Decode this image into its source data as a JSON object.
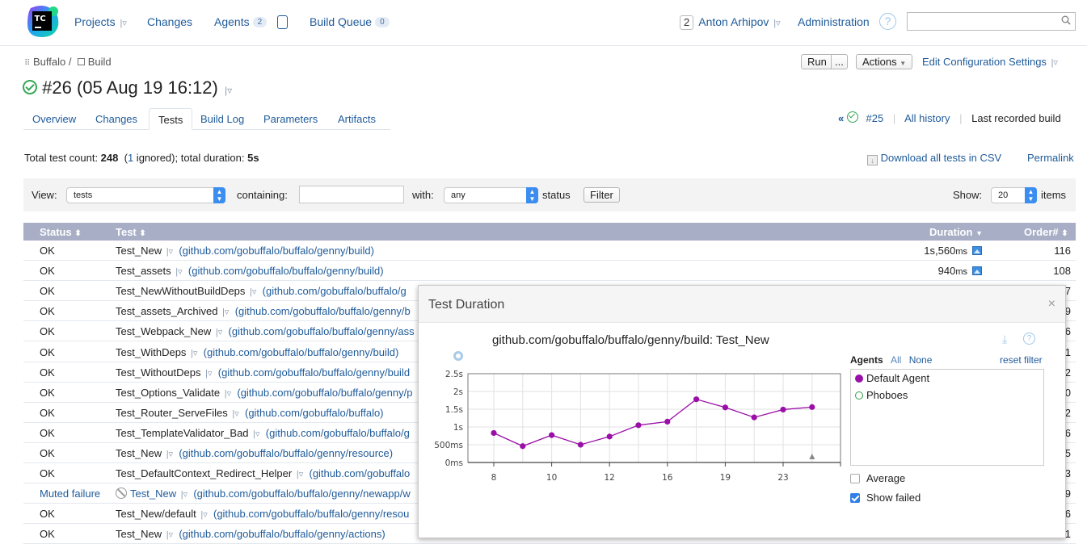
{
  "header": {
    "logo_text": "TC",
    "nav": {
      "projects": "Projects",
      "changes": "Changes",
      "agents": "Agents",
      "agents_count": "2",
      "build_queue": "Build Queue",
      "build_queue_count": "0"
    },
    "user_badge": "2",
    "user_name": "Anton Arhipov",
    "administration": "Administration",
    "search_placeholder": ""
  },
  "breadcrumb": {
    "project": "Buffalo",
    "separator": "/",
    "build_config": "Build"
  },
  "build": {
    "title": "#26 (05 Aug 19 16:12)",
    "status": "success"
  },
  "toolbar": {
    "run": "Run",
    "run_more": "...",
    "actions": "Actions",
    "edit_config": "Edit Configuration Settings"
  },
  "tabs": [
    {
      "label": "Overview"
    },
    {
      "label": "Changes"
    },
    {
      "label": "Tests",
      "active": true
    },
    {
      "label": "Build Log"
    },
    {
      "label": "Parameters"
    },
    {
      "label": "Artifacts"
    }
  ],
  "history_nav": {
    "prev_build": "#25",
    "all_history": "All history",
    "last_recorded": "Last recorded build"
  },
  "summary": {
    "prefix": "Total test count: ",
    "count": "248",
    "ignored_open": "(",
    "ignored_count": "1",
    "ignored_text": " ignored); total duration: ",
    "duration": "5s"
  },
  "links": {
    "download_csv": "Download all tests in CSV",
    "permalink": "Permalink"
  },
  "filter": {
    "view_label": "View:",
    "view_value": "tests",
    "containing_label": "containing:",
    "containing_value": "",
    "with_label": "with:",
    "with_value": "any",
    "status_label": "status",
    "filter_button": "Filter",
    "show_label": "Show:",
    "show_value": "20",
    "items_label": "items"
  },
  "table": {
    "columns": {
      "status": "Status",
      "test": "Test",
      "duration": "Duration",
      "order": "Order#"
    },
    "rows": [
      {
        "status": "OK",
        "name": "Test_New",
        "package": "(github.com/gobuffalo/buffalo/genny/build)",
        "duration": "1s,560",
        "duration_unit": "ms",
        "order": "116"
      },
      {
        "status": "OK",
        "name": "Test_assets",
        "package": "(github.com/gobuffalo/buffalo/genny/build)",
        "duration": "940",
        "duration_unit": "ms",
        "order": "108"
      },
      {
        "status": "OK",
        "name": "Test_NewWithoutBuildDeps",
        "package": "(github.com/gobuffalo/buffalo/g",
        "order": "7"
      },
      {
        "status": "OK",
        "name": "Test_assets_Archived",
        "package": "(github.com/gobuffalo/buffalo/genny/b",
        "order": "9"
      },
      {
        "status": "OK",
        "name": "Test_Webpack_New",
        "package": "(github.com/gobuffalo/buffalo/genny/ass",
        "order": "6"
      },
      {
        "status": "OK",
        "name": "Test_WithDeps",
        "package": "(github.com/gobuffalo/buffalo/genny/build)",
        "order": "1"
      },
      {
        "status": "OK",
        "name": "Test_WithoutDeps",
        "package": "(github.com/gobuffalo/buffalo/genny/build",
        "order": "2"
      },
      {
        "status": "OK",
        "name": "Test_Options_Validate",
        "package": "(github.com/gobuffalo/buffalo/genny/p",
        "order": "0"
      },
      {
        "status": "OK",
        "name": "Test_Router_ServeFiles",
        "package": "(github.com/gobuffalo/buffalo)",
        "order": "2"
      },
      {
        "status": "OK",
        "name": "Test_TemplateValidator_Bad",
        "package": "(github.com/gobuffalo/buffalo/g",
        "order": "6"
      },
      {
        "status": "OK",
        "name": "Test_New",
        "package": "(github.com/gobuffalo/buffalo/genny/resource)",
        "order": "5"
      },
      {
        "status": "OK",
        "name": "Test_DefaultContext_Redirect_Helper",
        "package": "(github.com/gobuffalo",
        "order": "3"
      },
      {
        "status": "Muted failure",
        "name": "Test_New",
        "package": "(github.com/gobuffalo/buffalo/genny/newapp/w",
        "order": "9",
        "muted": true
      },
      {
        "status": "OK",
        "name": "Test_New/default",
        "package": "(github.com/gobuffalo/buffalo/genny/resou",
        "order": "6"
      },
      {
        "status": "OK",
        "name": "Test_New",
        "package": "(github.com/gobuffalo/buffalo/genny/actions)",
        "order": "1"
      }
    ]
  },
  "popup": {
    "title": "Test Duration",
    "close": "×",
    "agents_label": "Agents",
    "all": "All",
    "none": "None",
    "reset_filter": "reset filter",
    "agents": [
      {
        "name": "Default Agent",
        "color": "#9a0fa8",
        "selected": true
      },
      {
        "name": "Phoboes",
        "color": "#2ea043",
        "selected": false
      }
    ],
    "average_label": "Average",
    "average_checked": false,
    "show_failed_label": "Show failed",
    "show_failed_checked": true
  },
  "chart_data": {
    "type": "line",
    "title": "github.com/gobuffalo/buffalo/genny/build: Test_New",
    "xlabel": "",
    "ylabel": "",
    "x_tick_labels": [
      "8",
      "10",
      "12",
      "16",
      "19",
      "23"
    ],
    "y_tick_labels": [
      "0ms",
      "500ms",
      "1s",
      "1.5s",
      "2s",
      "2.5s"
    ],
    "ylim": [
      0,
      2.5
    ],
    "y_unit": "s",
    "grid": true,
    "series": [
      {
        "name": "Default Agent",
        "color": "#9a0fa8",
        "points": [
          {
            "index": 0,
            "label": "8",
            "value": 0.83
          },
          {
            "index": 1,
            "label": "",
            "value": 0.46
          },
          {
            "index": 2,
            "label": "10",
            "value": 0.77
          },
          {
            "index": 3,
            "label": "",
            "value": 0.5
          },
          {
            "index": 4,
            "label": "12",
            "value": 0.73
          },
          {
            "index": 5,
            "label": "",
            "value": 1.05
          },
          {
            "index": 6,
            "label": "16",
            "value": 1.15
          },
          {
            "index": 7,
            "label": "",
            "value": 1.78
          },
          {
            "index": 8,
            "label": "19",
            "value": 1.55
          },
          {
            "index": 9,
            "label": "",
            "value": 1.27
          },
          {
            "index": 10,
            "label": "23",
            "value": 1.49
          },
          {
            "index": 11,
            "label": "",
            "value": 1.56
          }
        ]
      }
    ],
    "current_build_marker_index": 11
  },
  "colors": {
    "accent": "#1f5b9a",
    "table_header": "#a7aec5",
    "success": "#34a853",
    "series": "#9a0fa8"
  }
}
